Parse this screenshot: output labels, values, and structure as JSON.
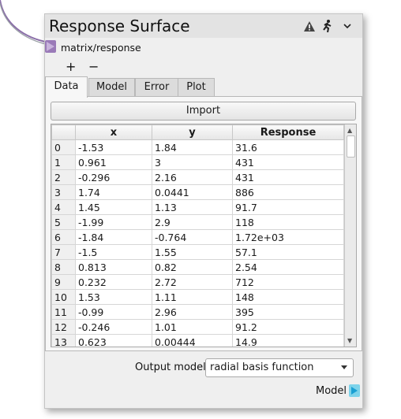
{
  "node": {
    "title": "Response Surface",
    "input_port_label": "matrix/response",
    "plus_label": "+",
    "minus_label": "−",
    "icons": [
      "warning-icon",
      "run-icon",
      "chevron-down-icon"
    ]
  },
  "tabs": [
    {
      "label": "Data",
      "active": true
    },
    {
      "label": "Model",
      "active": false
    },
    {
      "label": "Error",
      "active": false
    },
    {
      "label": "Plot",
      "active": false
    }
  ],
  "data_tab": {
    "import_label": "Import",
    "columns": [
      "",
      "x",
      "y",
      "Response"
    ],
    "rows": [
      [
        "0",
        "-1.53",
        "1.84",
        "31.6"
      ],
      [
        "1",
        "0.961",
        "3",
        "431"
      ],
      [
        "2",
        "-0.296",
        "2.16",
        "431"
      ],
      [
        "3",
        "1.74",
        "0.0441",
        "886"
      ],
      [
        "4",
        "1.45",
        "1.13",
        "91.7"
      ],
      [
        "5",
        "-1.99",
        "2.9",
        "118"
      ],
      [
        "6",
        "-1.84",
        "-0.764",
        "1.72e+03"
      ],
      [
        "7",
        "-1.5",
        "1.55",
        "57.1"
      ],
      [
        "8",
        "0.813",
        "0.82",
        "2.54"
      ],
      [
        "9",
        "0.232",
        "2.72",
        "712"
      ],
      [
        "10",
        "1.53",
        "1.11",
        "148"
      ],
      [
        "11",
        "-0.99",
        "2.96",
        "395"
      ],
      [
        "12",
        "-0.246",
        "1.01",
        "91.2"
      ],
      [
        "13",
        "0.623",
        "0.00444",
        "14.9"
      ]
    ]
  },
  "footer": {
    "output_model_label": "Output model",
    "output_model_value": "radial basis function",
    "model_port_label": "Model"
  },
  "colors": {
    "input_port": "#a77bc9",
    "output_port": "#7dd3ea"
  }
}
